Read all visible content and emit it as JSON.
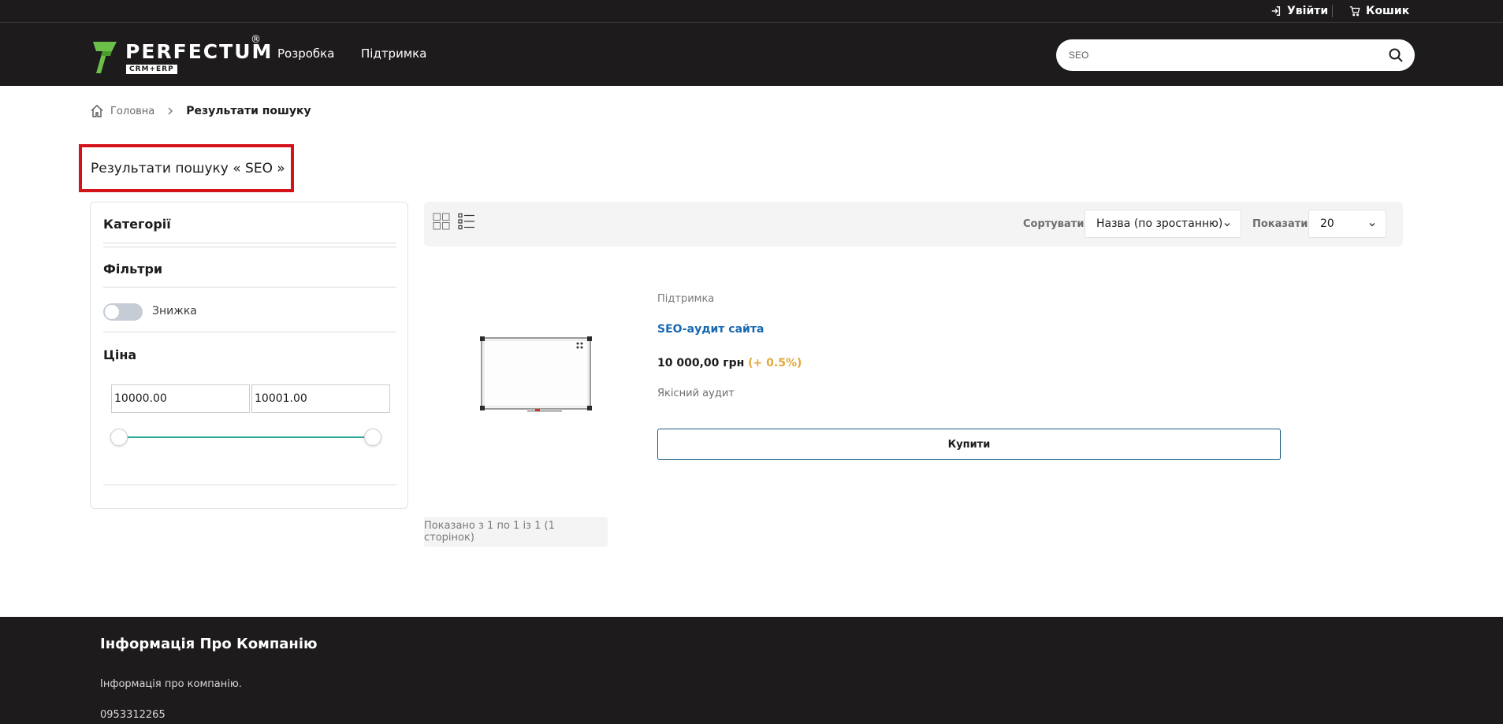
{
  "topbar": {
    "login_label": "Увійти",
    "cart_label": "Кошик"
  },
  "header": {
    "logo": {
      "text": "PERFECTUM",
      "registered": "®",
      "sub": "CRM+ERP"
    },
    "nav": [
      {
        "label": "Розробка"
      },
      {
        "label": "Підтримка"
      }
    ],
    "search": {
      "value": "SEO",
      "placeholder": "SEO"
    }
  },
  "breadcrumb": {
    "home_label": "Головна",
    "current_label": "Результати пошуку"
  },
  "page": {
    "title": "Результати пошуку « SEO »"
  },
  "sidebar": {
    "categories_heading": "Категорії",
    "filters_heading": "Фільтри",
    "discount_label": "Знижка",
    "discount_enabled": false,
    "price_heading": "Ціна",
    "price_min": "10000.00",
    "price_max": "10001.00"
  },
  "toolbar": {
    "sort_label": "Сортувати",
    "sort_value": "Назва (по зростанню)",
    "show_label": "Показати",
    "show_value": "20"
  },
  "product": {
    "category": "Підтримка",
    "title": "SEO-аудит сайта",
    "price": "10 000,00 грн",
    "tax": "(+ 0.5%)",
    "description": "Якісний аудит",
    "buy_label": "Купити"
  },
  "pagination": {
    "info": "Показано з 1 по 1 із 1 (1 сторінок)"
  },
  "footer": {
    "title": "Інформація Про Компанію",
    "info_text": "Інформація про компанію.",
    "phone": "0953312265"
  },
  "colors": {
    "header_bg": "#1e1b1c",
    "highlight_border": "#d3131a",
    "link_blue": "#1768b0",
    "tax_orange": "#e2a93b",
    "slider_teal": "#2aa89a",
    "logo_green": "#6cc04a"
  }
}
